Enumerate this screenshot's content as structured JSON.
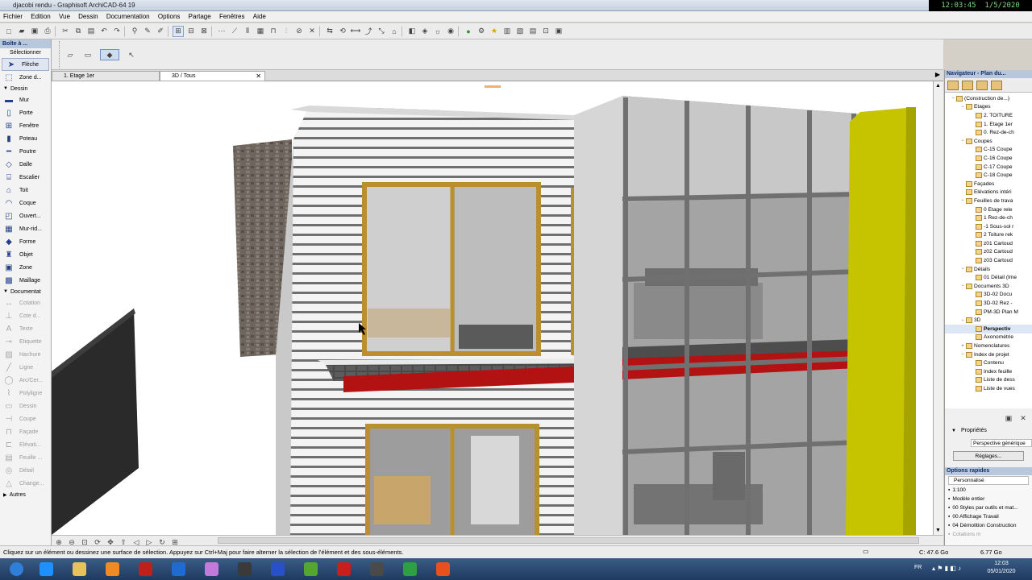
{
  "window": {
    "title": "djacobi rendu - Graphisoft ArchiCAD-64 19"
  },
  "clock": {
    "time": "12:03:45",
    "date": "1/5/2020"
  },
  "menu": [
    "Fichier",
    "Edition",
    "Vue",
    "Dessin",
    "Documentation",
    "Options",
    "Partage",
    "Fenêtres",
    "Aide"
  ],
  "toolbox": {
    "title": "Boîte à ...",
    "select_label": "Sélectionner",
    "arrow": "Flèche",
    "zone_label": "Zone d...",
    "section_dessin": "Dessin",
    "dessin_items": [
      {
        "label": "Mur",
        "icon": "wall-icon"
      },
      {
        "label": "Porte",
        "icon": "door-icon"
      },
      {
        "label": "Fenêtre",
        "icon": "window-icon"
      },
      {
        "label": "Poteau",
        "icon": "column-icon"
      },
      {
        "label": "Poutre",
        "icon": "beam-icon"
      },
      {
        "label": "Dalle",
        "icon": "slab-icon"
      },
      {
        "label": "Escalier",
        "icon": "stair-icon"
      },
      {
        "label": "Toit",
        "icon": "roof-icon"
      },
      {
        "label": "Coque",
        "icon": "shell-icon"
      },
      {
        "label": "Ouvert...",
        "icon": "opening-icon"
      },
      {
        "label": "Mur-rid...",
        "icon": "curtain-wall-icon"
      },
      {
        "label": "Forme",
        "icon": "morph-icon"
      },
      {
        "label": "Objet",
        "icon": "object-icon"
      },
      {
        "label": "Zone",
        "icon": "zone-icon"
      },
      {
        "label": "Maillage",
        "icon": "mesh-icon"
      }
    ],
    "section_doc": "Documentat",
    "doc_items": [
      {
        "label": "Cotation",
        "icon": "dimension-icon"
      },
      {
        "label": "Cote d...",
        "icon": "level-dim-icon"
      },
      {
        "label": "Texte",
        "icon": "text-icon"
      },
      {
        "label": "Etiquette",
        "icon": "label-icon"
      },
      {
        "label": "Hachure",
        "icon": "fill-icon"
      },
      {
        "label": "Ligne",
        "icon": "line-icon"
      },
      {
        "label": "Arc/Cer...",
        "icon": "arc-icon"
      },
      {
        "label": "Polyligne",
        "icon": "polyline-icon"
      },
      {
        "label": "Dessin",
        "icon": "drawing-icon"
      },
      {
        "label": "Coupe",
        "icon": "section-icon"
      },
      {
        "label": "Façade",
        "icon": "elevation-icon"
      },
      {
        "label": "Elévati...",
        "icon": "interior-elev-icon"
      },
      {
        "label": "Feuille ...",
        "icon": "worksheet-icon"
      },
      {
        "label": "Détail",
        "icon": "detail-icon"
      },
      {
        "label": "Change...",
        "icon": "change-icon"
      }
    ],
    "autres": "Autres"
  },
  "tabs": [
    {
      "label": "1. Etage 1er"
    },
    {
      "label": "3D / Tous"
    }
  ],
  "navigator": {
    "title": "Navigateur - Plan du...",
    "tree": [
      {
        "label": "(Construction de...)",
        "level": 0,
        "ex": "−"
      },
      {
        "label": "Etages",
        "level": 1,
        "ex": "−"
      },
      {
        "label": "2. TOITURE",
        "level": 2,
        "ex": ""
      },
      {
        "label": "1. Etage 1er",
        "level": 2,
        "ex": ""
      },
      {
        "label": "0. Rez-de-ch",
        "level": 2,
        "ex": ""
      },
      {
        "label": "Coupes",
        "level": 1,
        "ex": "−"
      },
      {
        "label": "C-15 Coupe",
        "level": 2,
        "ex": ""
      },
      {
        "label": "C-16 Coupe",
        "level": 2,
        "ex": ""
      },
      {
        "label": "C-17 Coupe",
        "level": 2,
        "ex": ""
      },
      {
        "label": "C-18 Coupe",
        "level": 2,
        "ex": ""
      },
      {
        "label": "Façades",
        "level": 1,
        "ex": ""
      },
      {
        "label": "Elévations intéri",
        "level": 1,
        "ex": ""
      },
      {
        "label": "Feuilles de trava",
        "level": 1,
        "ex": "−"
      },
      {
        "label": "0 Etage rele",
        "level": 2,
        "ex": ""
      },
      {
        "label": "1 Rez-de-ch",
        "level": 2,
        "ex": ""
      },
      {
        "label": "-1 Sous-sol r",
        "level": 2,
        "ex": ""
      },
      {
        "label": "2 Toiture rek",
        "level": 2,
        "ex": ""
      },
      {
        "label": "z01 Cartoud",
        "level": 2,
        "ex": ""
      },
      {
        "label": "z02 Cartoud",
        "level": 2,
        "ex": ""
      },
      {
        "label": "z03 Cartoud",
        "level": 2,
        "ex": ""
      },
      {
        "label": "Détails",
        "level": 1,
        "ex": "−"
      },
      {
        "label": "01 Détail (Ime",
        "level": 2,
        "ex": ""
      },
      {
        "label": "Documents 3D",
        "level": 1,
        "ex": "−"
      },
      {
        "label": "3D-02 Docu",
        "level": 2,
        "ex": ""
      },
      {
        "label": "3D-02 Rez -",
        "level": 2,
        "ex": ""
      },
      {
        "label": "PM-3D Plan M",
        "level": 2,
        "ex": ""
      },
      {
        "label": "3D",
        "level": 1,
        "ex": "−"
      },
      {
        "label": "Perspectiv",
        "level": 2,
        "ex": "",
        "selected": true
      },
      {
        "label": "Axonométrie",
        "level": 2,
        "ex": ""
      },
      {
        "label": "Nomenclatures",
        "level": 1,
        "ex": "+"
      },
      {
        "label": "Index de projet",
        "level": 1,
        "ex": "−"
      },
      {
        "label": "Contenu",
        "level": 2,
        "ex": ""
      },
      {
        "label": "Index feuille",
        "level": 2,
        "ex": ""
      },
      {
        "label": "Liste de dess",
        "level": 2,
        "ex": ""
      },
      {
        "label": "Liste de vues",
        "level": 2,
        "ex": ""
      }
    ]
  },
  "properties": {
    "title": "Propriétés",
    "value": "Perspective générique",
    "settings_button": "Réglages..."
  },
  "quick_options": {
    "title": "Options rapides",
    "preset": "Personnalisé",
    "items": [
      "1:100",
      "Modèle entier",
      "00 Styles par outils et mat...",
      "00 Affichage Travail",
      "04 Démolition Construction",
      "Cotations m"
    ]
  },
  "status": {
    "message": "Cliquez sur un élément ou dessinez une surface de sélection. Appuyez sur Ctrl+Maj pour faire alterner la sélection de l'élément et des sous-éléments.",
    "disk": "C: 47.6 Go",
    "ram": "6.77 Go"
  },
  "taskbar": {
    "time": "12:03",
    "date": "05/01/2020",
    "lang": "FR",
    "apps": [
      {
        "icon": "windows-start-icon",
        "color": "#2f7fd8"
      },
      {
        "icon": "internet-explorer-icon",
        "color": "#1e90ff"
      },
      {
        "icon": "file-explorer-icon",
        "color": "#e7c25a"
      },
      {
        "icon": "media-player-icon",
        "color": "#f08a24"
      },
      {
        "icon": "app-red-icon",
        "color": "#c0201a"
      },
      {
        "icon": "app-blue-icon",
        "color": "#1f6bd1"
      },
      {
        "icon": "itunes-icon",
        "color": "#c47adb"
      },
      {
        "icon": "archicad-icon",
        "color": "#3a3a3a"
      },
      {
        "icon": "app-vector-icon",
        "color": "#2850c8"
      },
      {
        "icon": "utorrent-icon",
        "color": "#55a630"
      },
      {
        "icon": "autocad-icon",
        "color": "#c81e1e"
      },
      {
        "icon": "sketch-app-icon",
        "color": "#4a4a4a"
      },
      {
        "icon": "camtasia-green-icon",
        "color": "#2ea043"
      },
      {
        "icon": "camtasia-icon",
        "color": "#e8501e"
      }
    ]
  },
  "colors": {
    "panel_header": "#b8c7dc",
    "window_frame": "#b8902e",
    "accent_yellow": "#c6c400",
    "slab_red": "#b31212"
  }
}
